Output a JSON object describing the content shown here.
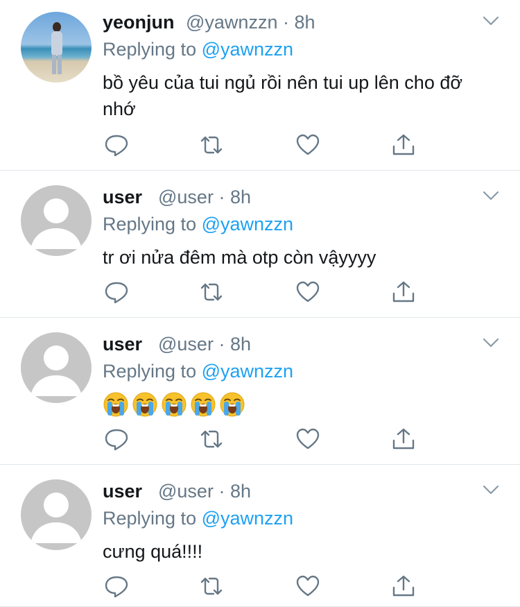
{
  "tweets": [
    {
      "username": "yeonjun",
      "handle": "@yawnzzn",
      "dot": "·",
      "time": "8h",
      "replying_prefix": "Replying to",
      "replying_to": "@yawnzzn",
      "text": "bồ yêu của tui ngủ rồi nên tui up lên cho đỡ nhớ",
      "avatar": "photo"
    },
    {
      "username": "user",
      "handle": "@user",
      "dot": "·",
      "time": "8h",
      "replying_prefix": "Replying to",
      "replying_to": "@yawnzzn",
      "text": "tr ơi nửa đêm mà otp còn vậyyyy",
      "avatar": "default"
    },
    {
      "username": "user",
      "handle": "@user",
      "dot": "·",
      "time": "8h",
      "replying_prefix": "Replying to",
      "replying_to": "@yawnzzn",
      "emoji": "loudly-crying-face",
      "emoji_count": 5,
      "avatar": "default"
    },
    {
      "username": "user",
      "handle": "@user",
      "dot": "·",
      "time": "8h",
      "replying_prefix": "Replying to",
      "replying_to": "@yawnzzn",
      "text": "cưng quá!!!!",
      "avatar": "default"
    }
  ],
  "icons": {
    "reply": "reply-icon",
    "retweet": "retweet-icon",
    "like": "heart-icon",
    "share": "share-icon",
    "menu": "chevron-down-icon"
  },
  "colors": {
    "link": "#1da1f2",
    "secondary_text": "#657786",
    "icon": "#657786",
    "divider": "#e1e8ed",
    "default_avatar": "#c6c6c6"
  }
}
